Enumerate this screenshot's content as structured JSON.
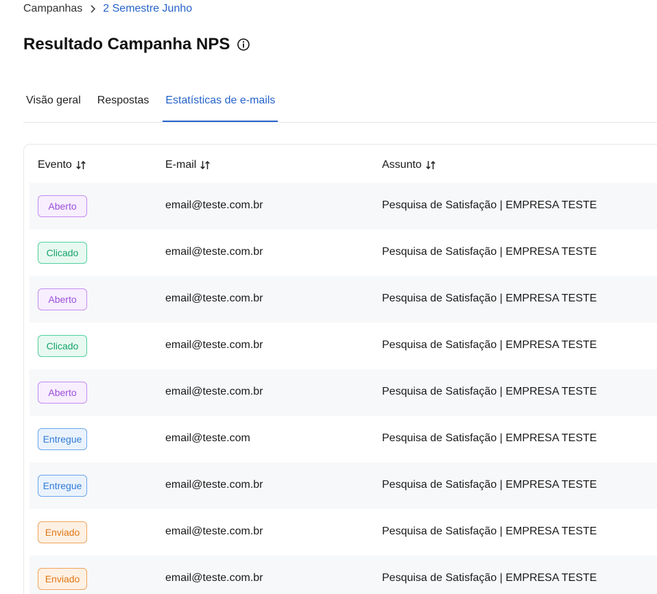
{
  "breadcrumb": {
    "root": "Campanhas",
    "current": "2 Semestre Junho"
  },
  "header": {
    "title": "Resultado Campanha NPS"
  },
  "tabs": [
    {
      "label": "Visão geral",
      "active": false
    },
    {
      "label": "Respostas",
      "active": false
    },
    {
      "label": "Estatísticas de e-mails",
      "active": true
    }
  ],
  "table": {
    "columns": [
      "Evento",
      "E-mail",
      "Assunto"
    ],
    "rows": [
      {
        "evento": "Aberto",
        "email": "email@teste.com.br",
        "assunto": "Pesquisa de Satisfação | EMPRESA TESTE"
      },
      {
        "evento": "Clicado",
        "email": "email@teste.com.br",
        "assunto": "Pesquisa de Satisfação | EMPRESA TESTE"
      },
      {
        "evento": "Aberto",
        "email": "email@teste.com.br",
        "assunto": "Pesquisa de Satisfação | EMPRESA TESTE"
      },
      {
        "evento": "Clicado",
        "email": "email@teste.com.br",
        "assunto": "Pesquisa de Satisfação | EMPRESA TESTE"
      },
      {
        "evento": "Aberto",
        "email": "email@teste.com.br",
        "assunto": "Pesquisa de Satisfação | EMPRESA TESTE"
      },
      {
        "evento": "Entregue",
        "email": "email@teste.com",
        "assunto": "Pesquisa de Satisfação | EMPRESA TESTE"
      },
      {
        "evento": "Entregue",
        "email": "email@teste.com.br",
        "assunto": "Pesquisa de Satisfação | EMPRESA TESTE"
      },
      {
        "evento": "Enviado",
        "email": "email@teste.com.br",
        "assunto": "Pesquisa de Satisfação | EMPRESA TESTE"
      },
      {
        "evento": "Enviado",
        "email": "email@teste.com.br",
        "assunto": "Pesquisa de Satisfação | EMPRESA TESTE"
      }
    ]
  },
  "colors": {
    "accent": "#2563c9",
    "aberto": "#9b4fdb",
    "clicado": "#14a36b",
    "entregue": "#2f7ad6",
    "enviado": "#e07614"
  },
  "icons": {
    "breadcrumb_separator": "chevron-right-icon",
    "title_info": "info-icon",
    "column_sort": "sort-icon"
  }
}
